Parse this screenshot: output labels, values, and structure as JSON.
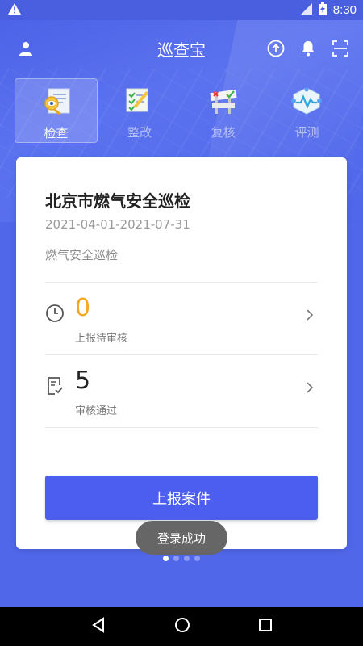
{
  "status_bar": {
    "time": "8:30"
  },
  "header": {
    "title": "巡查宝"
  },
  "tabs": [
    {
      "label": "检查",
      "active": true
    },
    {
      "label": "整改",
      "active": false
    },
    {
      "label": "复核",
      "active": false
    },
    {
      "label": "评测",
      "active": false
    }
  ],
  "card": {
    "title": "北京市燃气安全巡检",
    "date_range": "2021-04-01-2021-07-31",
    "description": "燃气安全巡检",
    "stats": [
      {
        "value": "0",
        "label": "上报待审核",
        "color": "#f5a623"
      },
      {
        "value": "5",
        "label": "审核通过",
        "color": "#222222"
      }
    ],
    "submit_label": "上报案件"
  },
  "toast": "登录成功",
  "pager": {
    "current": 1,
    "total": 4
  },
  "colors": {
    "primary": "#4b5ef0",
    "header_bg": "#5167ea",
    "accent_orange": "#f5a623"
  }
}
